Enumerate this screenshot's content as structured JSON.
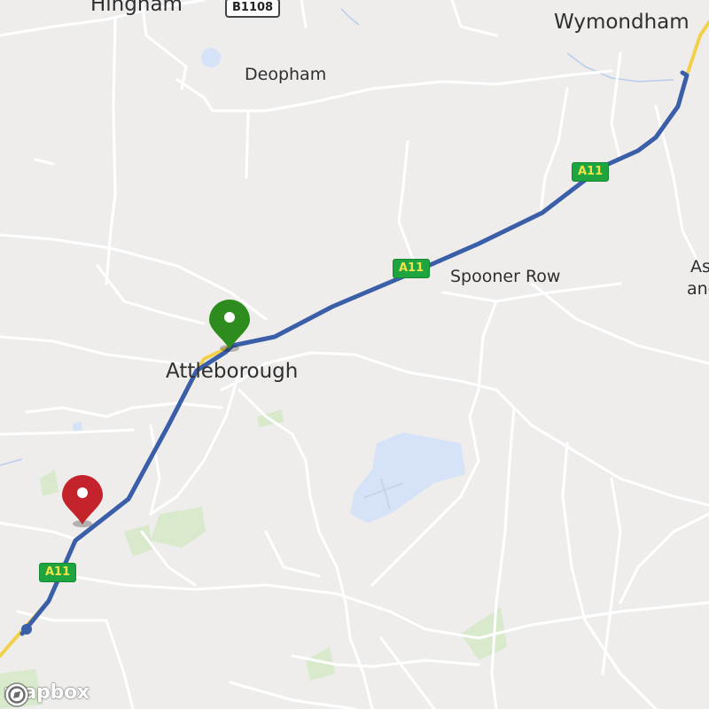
{
  "places": {
    "hingham": "Hingham",
    "deopham": "Deopham",
    "wymondham": "Wymondham",
    "spooner_row": "Spooner Row",
    "attleborough": "Attleborough",
    "ashwellthorpe_top": "As",
    "ashwellthorpe_bottom": "and"
  },
  "road_shields": {
    "b1108": "B1108",
    "a11_north": "A11",
    "a11_mid": "A11",
    "a11_south": "A11"
  },
  "markers": {
    "start": {
      "color": "#2e8b1e",
      "icon": "map-pin-icon"
    },
    "end": {
      "color": "#c4232b",
      "icon": "map-pin-icon"
    }
  },
  "route": {
    "color": "#3a5fa8"
  },
  "attribution": {
    "logo_text": "mapbox"
  },
  "colors": {
    "land": "#efedeb",
    "road": "#ffffff",
    "trunk_road": "#f2d04a",
    "water": "#d6e2f7",
    "park": "#d8e9cc"
  }
}
